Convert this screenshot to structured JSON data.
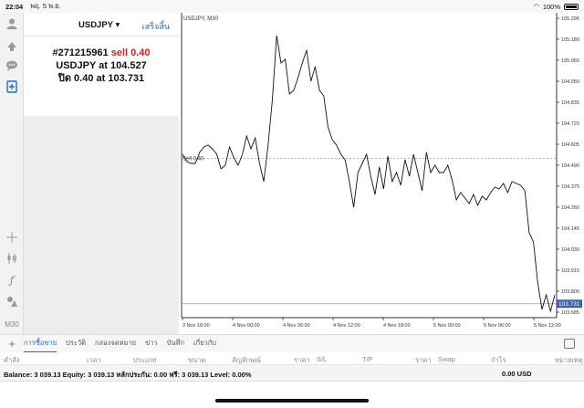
{
  "status_bar": {
    "time": "22:04",
    "date": "พฤ. 5 พ.ย.",
    "battery_text": "100%"
  },
  "order": {
    "symbol": "USDJPY",
    "done_label": "เสร็จสิ้น",
    "ticket": "#271215961",
    "action": "sell 0.40",
    "line2_prefix": "USDJPY at",
    "line2_price": "104.527",
    "line3_prefix": "ปิด 0.40 at",
    "line3_price": "103.731"
  },
  "left_toolbar": {
    "timeframe": "M30"
  },
  "chart_data": {
    "type": "line",
    "title": "USDJPY, M30",
    "x_tick_labels": [
      "3 Nov 18:00",
      "4 Nov 00:00",
      "4 Nov 06:00",
      "4 Nov 12:00",
      "4 Nov 18:00",
      "5 Nov 00:00",
      "5 Nov 06:00",
      "5 Nov 12:00"
    ],
    "y_tick_labels": [
      "105.295",
      "105.180",
      "105.065",
      "104.950",
      "104.835",
      "104.720",
      "104.605",
      "104.490",
      "104.375",
      "104.260",
      "104.145",
      "104.030",
      "103.915",
      "103.800",
      "103.685"
    ],
    "ylim": [
      103.655,
      105.325
    ],
    "values": [
      104.55,
      104.51,
      104.5,
      104.5,
      104.56,
      104.59,
      104.6,
      104.58,
      104.55,
      104.47,
      104.49,
      104.59,
      104.53,
      104.49,
      104.55,
      104.65,
      104.58,
      104.64,
      104.5,
      104.4,
      104.6,
      104.85,
      105.2,
      105.05,
      105.07,
      104.88,
      104.9,
      104.97,
      105.05,
      105.12,
      104.95,
      105.03,
      104.9,
      104.87,
      104.7,
      104.63,
      104.6,
      104.55,
      104.52,
      104.4,
      104.26,
      104.45,
      104.5,
      104.55,
      104.43,
      104.33,
      104.48,
      104.36,
      104.54,
      104.4,
      104.45,
      104.38,
      104.52,
      104.43,
      104.55,
      104.45,
      104.35,
      104.56,
      104.45,
      104.49,
      104.45,
      104.45,
      104.49,
      104.41,
      104.3,
      104.34,
      104.31,
      104.28,
      104.33,
      104.27,
      104.32,
      104.3,
      104.34,
      104.37,
      104.36,
      104.39,
      104.34,
      104.4,
      104.39,
      104.38,
      104.35,
      104.12,
      104.07,
      103.85,
      103.7,
      103.78,
      103.69,
      103.78
    ],
    "position_line": {
      "label": "Sell 0.40",
      "value": 104.527
    },
    "current_price": {
      "label": "103.731",
      "value": 103.731,
      "color": "#3a63a8"
    },
    "grid": false
  },
  "tabs": {
    "items": [
      {
        "label": "การซื้อขาย",
        "active": true
      },
      {
        "label": "ประวัติ",
        "active": false
      },
      {
        "label": "กล่องจดหมาย",
        "active": false
      },
      {
        "label": "ข่าว",
        "active": false
      },
      {
        "label": "บันทึก",
        "active": false
      },
      {
        "label": "เกี่ยวกับ",
        "active": false
      }
    ]
  },
  "trade_table": {
    "columns": [
      "คำสั่ง",
      "เวลา",
      "ประเภท",
      "ขนาด",
      "สัญลักษณ์",
      "ราคา",
      "S/L",
      "T/P",
      "ราคา",
      "Swap",
      "กำไร",
      "หมายเหตุ"
    ]
  },
  "balance": {
    "text": "Balance: 3 039.13 Equity: 3 039.13 หลักประกัน: 0.00 ฟรี: 3 039.13 Level: 0.00%",
    "profit": "0.00  USD"
  },
  "colors": {
    "accent": "#1d6fd3",
    "sell": "#d0232a",
    "price_tag": "#3a63a8"
  }
}
